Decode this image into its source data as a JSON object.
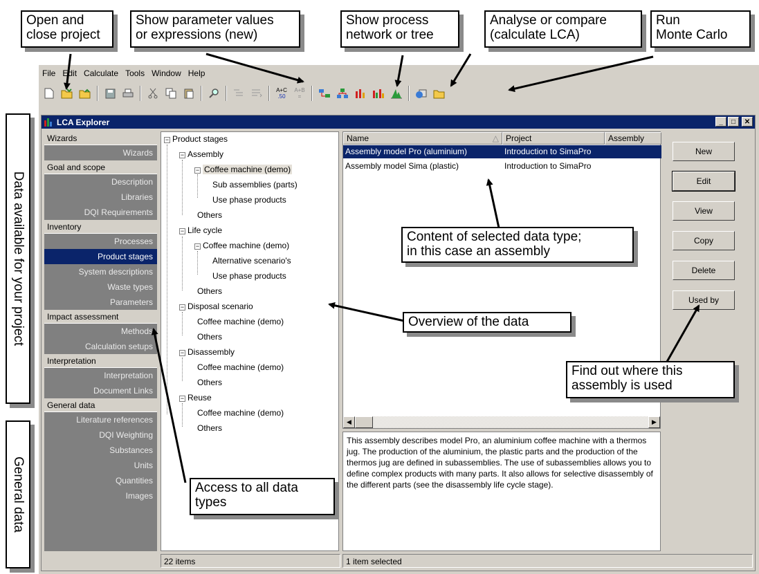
{
  "callouts": {
    "open_close": "Open and\nclose project",
    "show_params": "Show parameter values\nor expressions (new)",
    "show_network": "Show process\nnetwork or tree",
    "analyse": "Analyse  or compare\n(calculate LCA)",
    "monte_carlo": "Run\nMonte Carlo",
    "data_available": "Data available for your project",
    "general_data": "General data",
    "content": "Content of selected data type;\nin this case an assembly",
    "overview": "Overview of the  data",
    "find_out": "Find out where this\nassembly is used",
    "access": "Access to all data\ntypes"
  },
  "menu": [
    "File",
    "Edit",
    "Calculate",
    "Tools",
    "Window",
    "Help"
  ],
  "toolbar": {
    "param_top": "A+C",
    "param_bottom": ".50",
    "param2_top": "A+B",
    "param2_bottom": "="
  },
  "window": {
    "title": "LCA Explorer"
  },
  "sidebar": {
    "sections": [
      {
        "header": "Wizards",
        "items": [
          "Wizards"
        ]
      },
      {
        "header": "Goal and scope",
        "items": [
          "Description",
          "Libraries",
          "DQI Requirements"
        ]
      },
      {
        "header": "Inventory",
        "items": [
          "Processes",
          "Product stages",
          "System descriptions",
          "Waste types",
          "Parameters"
        ]
      },
      {
        "header": "Impact assessment",
        "items": [
          "Methods",
          "Calculation setups"
        ]
      },
      {
        "header": "Interpretation",
        "items": [
          "Interpretation",
          "Document Links"
        ]
      },
      {
        "header": "General data",
        "items": [
          "Literature references",
          "DQI Weighting",
          "Substances",
          "Units",
          "Quantities",
          "Images"
        ]
      }
    ],
    "selected": "Product stages"
  },
  "tree": {
    "root": "Product stages",
    "assembly": "Assembly",
    "assembly_coffee": "Coffee machine (demo)",
    "sub_assemblies": "Sub assemblies (parts)",
    "use_phase_1": "Use phase products",
    "others_1": "Others",
    "life_cycle": "Life cycle",
    "lc_coffee": "Coffee machine (demo)",
    "alt_scenarios": "Alternative scenario's",
    "use_phase_2": "Use phase products",
    "others_2": "Others",
    "disposal": "Disposal scenario",
    "disp_coffee": "Coffee machine (demo)",
    "others_3": "Others",
    "disassembly": "Disassembly",
    "dis_coffee": "Coffee machine (demo)",
    "others_4": "Others",
    "reuse": "Reuse",
    "reuse_coffee": "Coffee machine (demo)",
    "others_5": "Others"
  },
  "list": {
    "columns": [
      "Name",
      "Project",
      "Assembly"
    ],
    "rows": [
      {
        "name": "Assembly model Pro (aluminium)",
        "project": "Introduction to SimaPro"
      },
      {
        "name": "Assembly model Sima (plastic)",
        "project": "Introduction to SimaPro"
      }
    ]
  },
  "description": "This assembly describes model Pro, an aluminium coffee machine with a thermos jug. The production of the aluminium, the plastic parts and the production of the thermos jug are defined in subassemblies. The use of subassemblies allows you to define complex products with many parts. It also allows for selective disassembly of the different parts (see  the disassembly life cycle stage).",
  "buttons": [
    "New",
    "Edit",
    "View",
    "Copy",
    "Delete",
    "Used by"
  ],
  "status": {
    "left": "22 items",
    "right": "1 item selected"
  },
  "colors": {
    "selection": "#0a246a",
    "chrome": "#d4d0c8"
  }
}
